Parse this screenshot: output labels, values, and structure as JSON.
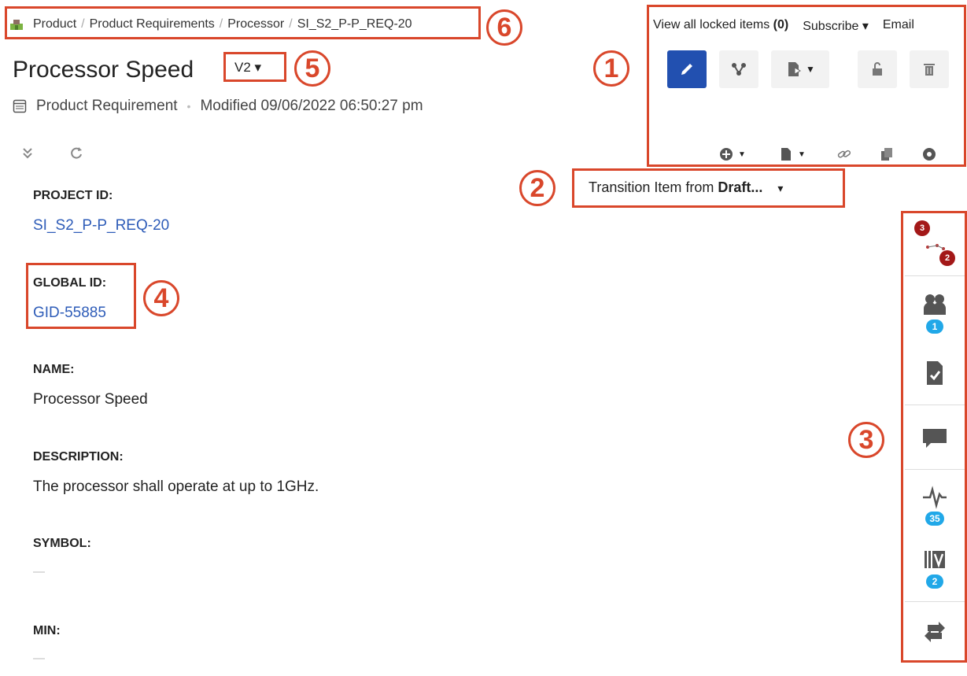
{
  "breadcrumb": {
    "items": [
      "Product",
      "Product Requirements",
      "Processor",
      "SI_S2_P-P_REQ-20"
    ],
    "separator": "/"
  },
  "item": {
    "title": "Processor Speed",
    "version": "V2 ▾",
    "type": "Product Requirement",
    "modified": "Modified 09/06/2022 06:50:27 pm"
  },
  "fields": [
    {
      "label": "PROJECT ID:",
      "value": "SI_S2_P-P_REQ-20"
    },
    {
      "label": "GLOBAL ID:",
      "value": "GID-55885"
    },
    {
      "label": "NAME:",
      "value": "Processor Speed"
    },
    {
      "label": "DESCRIPTION:",
      "value": "The processor shall operate at up to 1GHz."
    },
    {
      "label": "SYMBOL:",
      "value": "—"
    },
    {
      "label": "MIN:",
      "value": "—"
    }
  ],
  "toolbar": {
    "locked_label": "View all locked items",
    "locked_count": "(0)",
    "subscribe": "Subscribe ▾",
    "email": "Email"
  },
  "transition": {
    "prefix": "Transition Item from ",
    "state": "Draft...",
    "caret": "▾"
  },
  "sidebar": {
    "relationships_badges": [
      "3",
      "2"
    ],
    "reviews_badge": "1",
    "activity_badge": "35",
    "versions_badge": "2"
  },
  "callouts": [
    "1",
    "2",
    "3",
    "4",
    "5",
    "6"
  ],
  "colors": {
    "callout": "#d9472b",
    "link": "#2e5cb8",
    "active_button": "#2250b0",
    "badge_blue": "#21a8e8",
    "badge_red": "#a31818"
  }
}
